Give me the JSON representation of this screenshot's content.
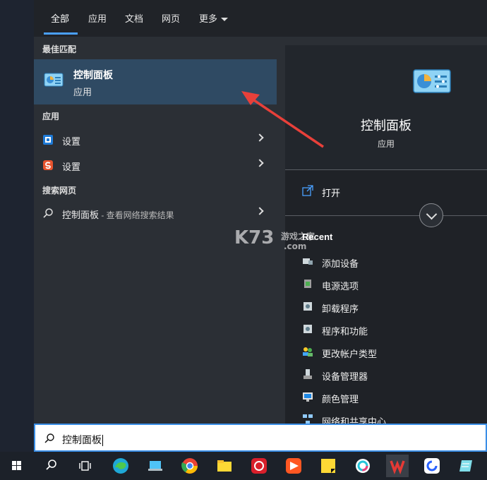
{
  "tabs": [
    {
      "label": "全部"
    },
    {
      "label": "应用"
    },
    {
      "label": "文档"
    },
    {
      "label": "网页"
    },
    {
      "label": "更多"
    }
  ],
  "sections": {
    "best_match": "最佳匹配",
    "apps": "应用",
    "web": "搜索网页"
  },
  "best_match_item": {
    "title": "控制面板",
    "subtitle": "应用"
  },
  "app_items": [
    {
      "label": "设置"
    },
    {
      "label": "设置"
    }
  ],
  "web_item": {
    "label": "控制面板",
    "suffix": " - 查看网络搜索结果"
  },
  "right_pane": {
    "title": "控制面板",
    "subtitle": "应用",
    "open_label": "打开",
    "recent_label": "Recent",
    "recent_items": [
      {
        "label": "添加设备"
      },
      {
        "label": "电源选项"
      },
      {
        "label": "卸载程序"
      },
      {
        "label": "程序和功能"
      },
      {
        "label": "更改帐户类型"
      },
      {
        "label": "设备管理器"
      },
      {
        "label": "颜色管理"
      },
      {
        "label": "网络和共享中心"
      }
    ]
  },
  "search": {
    "value": "控制面板"
  },
  "watermark": {
    "brand": "K73",
    "tagline": "游戏之家",
    "domain": ".com"
  },
  "colors": {
    "accent": "#4aa0ff",
    "selected": "#2f4a63",
    "annotation_arrow": "#e8403a"
  }
}
